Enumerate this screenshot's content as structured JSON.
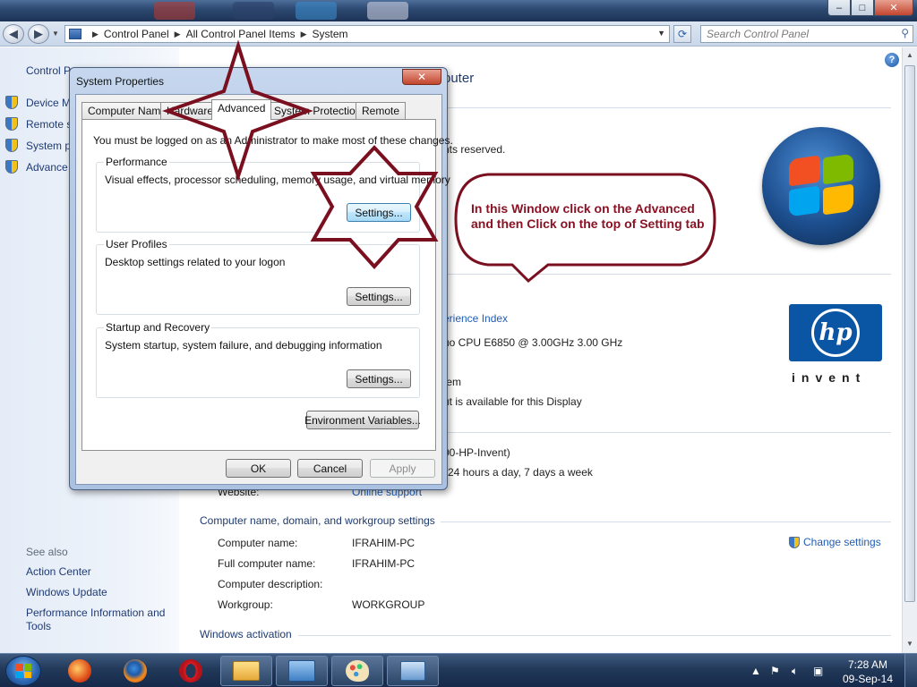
{
  "addressbar": {
    "crumbs": [
      "Control Panel",
      "All Control Panel Items",
      "System"
    ]
  },
  "search": {
    "placeholder": "Search Control Panel"
  },
  "window_controls": {
    "minimize": "–",
    "maximize": "□",
    "close": "✕"
  },
  "left_pane": {
    "home_partial": "Control P",
    "items": [
      {
        "label": "Device M",
        "icon": "shield-icon"
      },
      {
        "label": "Remote s",
        "icon": "shield-icon"
      },
      {
        "label": "System p",
        "icon": "shield-icon"
      },
      {
        "label": "Advance",
        "icon": "shield-icon"
      }
    ],
    "see_also": "See also",
    "links": [
      "Action Center",
      "Windows Update",
      "Performance Information and Tools"
    ]
  },
  "main": {
    "title_partial": "puter",
    "rights_partial": "nts reserved.",
    "experience_index_partial": "erience Index",
    "processor_partial": "uo CPU    E6850  @ 3.00GHz  3.00 GHz",
    "system_type_partial": "tem",
    "pen_touch_partial": "ut is available for this Display",
    "support_phone_partial": "00-HP-Invent)",
    "support_hours_partial": "24 hours a day, 7 days a week",
    "website_label": "Website:",
    "website_value": "Online support",
    "computer_section_title": "Computer name, domain, and workgroup settings",
    "computer_rows": [
      {
        "label": "Computer name:",
        "value": "IFRAHIM-PC"
      },
      {
        "label": "Full computer name:",
        "value": "IFRAHIM-PC"
      },
      {
        "label": "Computer description:",
        "value": ""
      },
      {
        "label": "Workgroup:",
        "value": "WORKGROUP"
      }
    ],
    "change_settings": "Change settings",
    "activation_section_title": "Windows activation",
    "hp_invent": "invent",
    "hp_mark": "hp"
  },
  "dialog": {
    "title": "System Properties",
    "close": "✕",
    "tabs": [
      {
        "label": "Computer Name",
        "active": false
      },
      {
        "label": "Hardware",
        "active": false
      },
      {
        "label": "Advanced",
        "active": true
      },
      {
        "label": "System Protection",
        "active": false
      },
      {
        "label": "Remote",
        "active": false
      }
    ],
    "admin_note": "You must be logged on as an Administrator to make most of these changes.",
    "groups": [
      {
        "title": "Performance",
        "description": "Visual effects, processor scheduling, memory usage, and virtual memory",
        "button": "Settings..."
      },
      {
        "title": "User Profiles",
        "description": "Desktop settings related to your logon",
        "button": "Settings..."
      },
      {
        "title": "Startup and Recovery",
        "description": "System startup, system failure, and debugging information",
        "button": "Settings..."
      }
    ],
    "env_button": "Environment Variables...",
    "ok": "OK",
    "cancel": "Cancel",
    "apply": "Apply"
  },
  "annotation": {
    "callout": "In this Window click on the Advanced and then Click on the top of Setting tab",
    "color": "#7a0f1f"
  },
  "taskbar": {
    "apps": [
      "start-button",
      "media-player-icon",
      "firefox-icon",
      "opera-icon",
      "file-explorer-icon",
      "control-panel-icon",
      "paint-icon",
      "system-properties-icon"
    ],
    "time": "7:28 AM",
    "date": "09-Sep-14"
  },
  "colors": {
    "link": "#1f5db4",
    "heading": "#1e3a6e",
    "taskbar": "#22395a"
  }
}
